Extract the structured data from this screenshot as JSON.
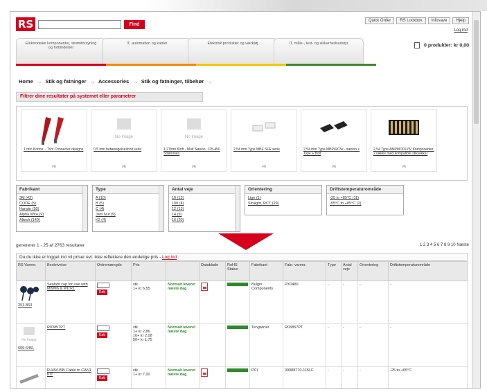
{
  "header": {
    "logo_text": "RS",
    "search_placeholder": "",
    "find_label": "Find",
    "top_links": [
      "Quick Order",
      "RS Lockbox",
      "Infosave",
      "Hjelp"
    ],
    "login_label": "Log ind",
    "basket_label": "0 produkter: kr 0,00"
  },
  "categories": [
    {
      "label": "Elektroniske komponenter, strømforsyning og forbindelser",
      "color": "#d6001c"
    },
    {
      "label": "IT, automation og kabler",
      "color": "#ef8b00"
    },
    {
      "label": "Elektrisk produkter og værktøj",
      "color": "#f5c800"
    },
    {
      "label": "IT, måle-, test- og sikkerhedsudstyr",
      "color": "#3c8a2c"
    }
  ],
  "breadcrumb": [
    "Home",
    "Stik og fatninger",
    "Accessories",
    "Stik og fatninger, tilbehør"
  ],
  "filter_heading": "Filtrer dine resultater på systemet eller parametrer",
  "gallery": [
    {
      "text": "1 mm Konne. - Tool Connector designs",
      "count": "(4)",
      "img": "red"
    },
    {
      "text": "0,5 mm befæstigelsesbolt serie",
      "count": "(4)",
      "img": "noimage"
    },
    {
      "text": "1,27mm Kloft - Mult Sæson, 125-450 Strømmen",
      "count": "(4)",
      "img": "noimage"
    },
    {
      "text": "2,54 mm Type MBF SFE serie",
      "count": "(4)",
      "img": "white"
    },
    {
      "text": "2,54 mm Type MBP/RCN/ - sæson + Type + Bolt",
      "count": "(4)",
      "img": "black"
    },
    {
      "text": "2,54 Type AMPMODU/IV Komponenter, 2 række med kompatible stiksekker",
      "count": "(4)",
      "img": "connector"
    }
  ],
  "filters": [
    {
      "head": "Fabrikant",
      "opts": [
        "3M (43)",
        "CODE (5)",
        "Harwin (50)",
        "Alpha Wire (9)",
        "Altech (140)"
      ]
    },
    {
      "head": "Type",
      "opts": [
        "A (10)",
        "B (5)",
        "C (4)",
        "Jam Nut (9)",
        "K2 (4)"
      ]
    },
    {
      "head": "Antal veje",
      "opts": [
        "10 (13)",
        "100 (4)",
        "12 (13)",
        "14 (9)",
        "16 (20)"
      ]
    },
    {
      "head": "Orientering",
      "opts": [
        "Lige (1)",
        "Straight, RCT (29)"
      ]
    },
    {
      "head": "Driftstemperaturområde",
      "opts": [
        "-25 to +85°C (11)",
        "-55°C to +85°C (2)"
      ]
    }
  ],
  "results": {
    "count_text": "genererer 1 - 25 af 2763 resultater",
    "pager": "1 2 3 4 5 6 7 8 9 10 Næste",
    "login_msg": "Du du ikke er logget ind vil priser evt. ikke reflektere den endelige pris -",
    "login_link": "Log ind",
    "columns": [
      "RS Varenr.",
      "Beskrivelse",
      "Ordremængde",
      "Pris",
      "",
      "Datablade",
      "RoHS Status",
      "Fabrikant",
      "Fabr. varenr.",
      "Type",
      "Antal veje",
      "Orientering",
      "Driftstemperaturområde"
    ],
    "rows": [
      {
        "rs_no": "291-863",
        "desc": "Sealant cap for use with M8/M6 & M10x1",
        "price": "stk\n1+ kr 6,55",
        "stock": "Normalt leveret næste dag",
        "datasheet": true,
        "mfr": "Bulgin Components",
        "mfr_no": "PX0480",
        "type": "-",
        "ways": "-",
        "orient": "-",
        "temp": "-"
      },
      {
        "rs_no": "699-6451",
        "desc": "R03857PT",
        "price": "stk\n1+ kr 2,86\n10+ kr 2,08\n50+ kr 1,75",
        "stock": "Normalt leveret næste dag",
        "datasheet": false,
        "mfr": "Tengwirter",
        "mfr_no": "R03857PT",
        "type": "-",
        "ways": "-",
        "orient": "-",
        "temp": "-"
      },
      {
        "rs_no": "",
        "desc": "RJ45/USB Cable to CAN1 KIT",
        "price": "stk\n1+ kr 7,00",
        "stock": "Normalt leveret næste dag",
        "datasheet": true,
        "mfr": "PCI",
        "mfr_no": "09088770-115LF",
        "type": "-",
        "ways": "-",
        "orient": "-",
        "temp": "-25 to +65°C"
      }
    ]
  },
  "buy_label": "Køb",
  "no_image_label": "No Image"
}
